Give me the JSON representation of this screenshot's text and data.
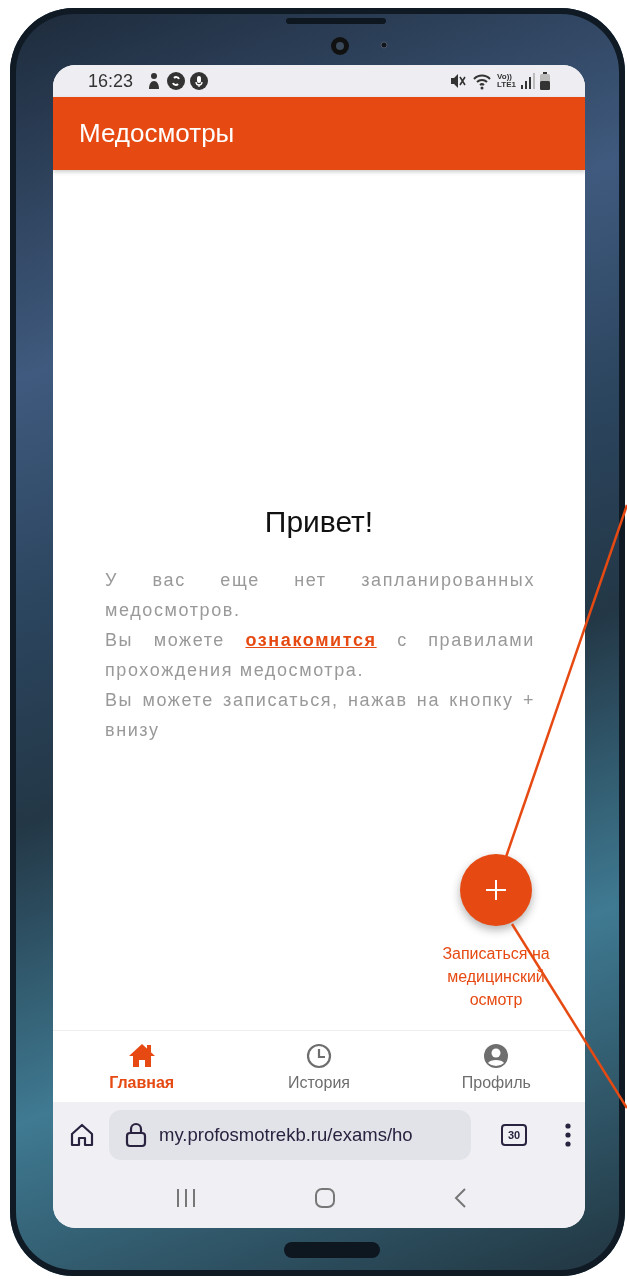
{
  "status_bar": {
    "time": "16:23",
    "network_top": "Vo))",
    "network_bottom": "LTE1"
  },
  "app_bar": {
    "title": "Медосмотры"
  },
  "content": {
    "greeting": "Привет!",
    "paragraphs": [
      {
        "text": "У вас еще нет запланированных медосмотров."
      },
      {
        "before": "Вы можете ",
        "link": "ознакомится",
        "after": " с правилами прохождения медосмотра."
      },
      {
        "text": "Вы можете записаться, нажав на кнопку + внизу"
      }
    ]
  },
  "fab": {
    "label": "Записаться на медицинский осмотр"
  },
  "bottom_nav": [
    {
      "kind": "home",
      "label": "Главная",
      "selected": true
    },
    {
      "kind": "history",
      "label": "История",
      "selected": false
    },
    {
      "kind": "profile",
      "label": "Профиль",
      "selected": false
    }
  ],
  "browser_bar": {
    "url": "my.profosmotrekb.ru/exams/ho",
    "tab_count": "30"
  }
}
